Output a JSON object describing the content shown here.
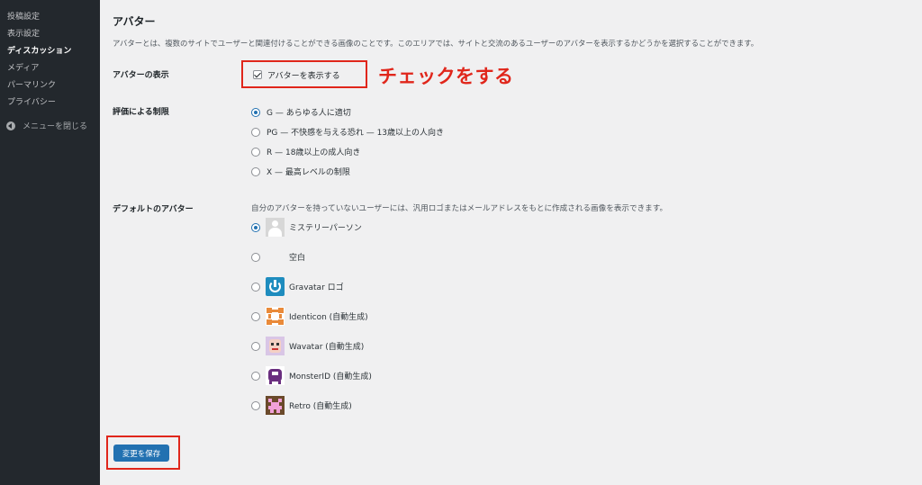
{
  "sidebar": {
    "items": [
      {
        "label": "投稿設定"
      },
      {
        "label": "表示設定"
      },
      {
        "label": "ディスカッション"
      },
      {
        "label": "メディア"
      },
      {
        "label": "パーマリンク"
      },
      {
        "label": "プライバシー"
      }
    ],
    "collapse_label": "メニューを閉じる"
  },
  "section": {
    "title": "アバター",
    "description": "アバターとは、複数のサイトでユーザーと関連付けることができる画像のことです。このエリアでは、サイトと交流のあるユーザーのアバターを表示するかどうかを選択することができます。"
  },
  "show_avatars": {
    "label": "アバターの表示",
    "checkbox_label": "アバターを表示する",
    "checked": true
  },
  "annotation": {
    "text": "チェックをする",
    "color": "#e0261b"
  },
  "rating": {
    "label": "評価による制限",
    "options": [
      {
        "label": "G — あらゆる人に適切",
        "checked": true
      },
      {
        "label": "PG — 不快感を与える恐れ — 13歳以上の人向き",
        "checked": false
      },
      {
        "label": "R — 18歳以上の成人向き",
        "checked": false
      },
      {
        "label": "X — 最高レベルの制限",
        "checked": false
      }
    ]
  },
  "default_avatar": {
    "label": "デフォルトのアバター",
    "description": "自分のアバターを持っていないユーザーには、汎用ロゴまたはメールアドレスをもとに作成される画像を表示できます。",
    "options": [
      {
        "label": "ミステリーパーソン",
        "icon": "mystery-person-icon",
        "checked": true
      },
      {
        "label": "空白",
        "icon": "blank-icon",
        "checked": false
      },
      {
        "label": "Gravatar ロゴ",
        "icon": "gravatar-logo-icon",
        "checked": false
      },
      {
        "label": "Identicon (自動生成)",
        "icon": "identicon-icon",
        "checked": false
      },
      {
        "label": "Wavatar (自動生成)",
        "icon": "wavatar-icon",
        "checked": false
      },
      {
        "label": "MonsterID (自動生成)",
        "icon": "monsterid-icon",
        "checked": false
      },
      {
        "label": "Retro (自動生成)",
        "icon": "retro-icon",
        "checked": false
      }
    ]
  },
  "save_button": {
    "label": "変更を保存"
  },
  "colors": {
    "sidebar_bg": "#23282d",
    "primary": "#2271b1",
    "highlight_red": "#e0261b",
    "page_bg": "#f0f0f1"
  }
}
